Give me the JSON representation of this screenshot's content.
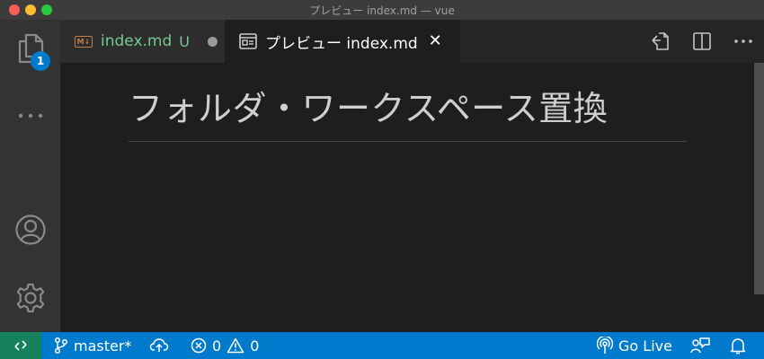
{
  "window": {
    "title": "プレビュー index.md — vue"
  },
  "activity_bar": {
    "explorer_badge": "1"
  },
  "tabs": [
    {
      "label": "index.md",
      "git_status": "U",
      "icon": "markdown-icon",
      "state": "modified"
    },
    {
      "label": "プレビュー index.md",
      "icon": "preview-icon",
      "state": "active"
    }
  ],
  "tab_actions": [
    "open-source-icon",
    "split-editor-icon",
    "more-actions-icon"
  ],
  "preview": {
    "heading": "フォルダ・ワークスペース置換"
  },
  "status_bar": {
    "branch": "master*",
    "errors": "0",
    "warnings": "0",
    "go_live": "Go Live"
  },
  "colors": {
    "status_bar": "#007acc",
    "remote": "#16825d",
    "untracked": "#73c991",
    "badge": "#007acc"
  }
}
